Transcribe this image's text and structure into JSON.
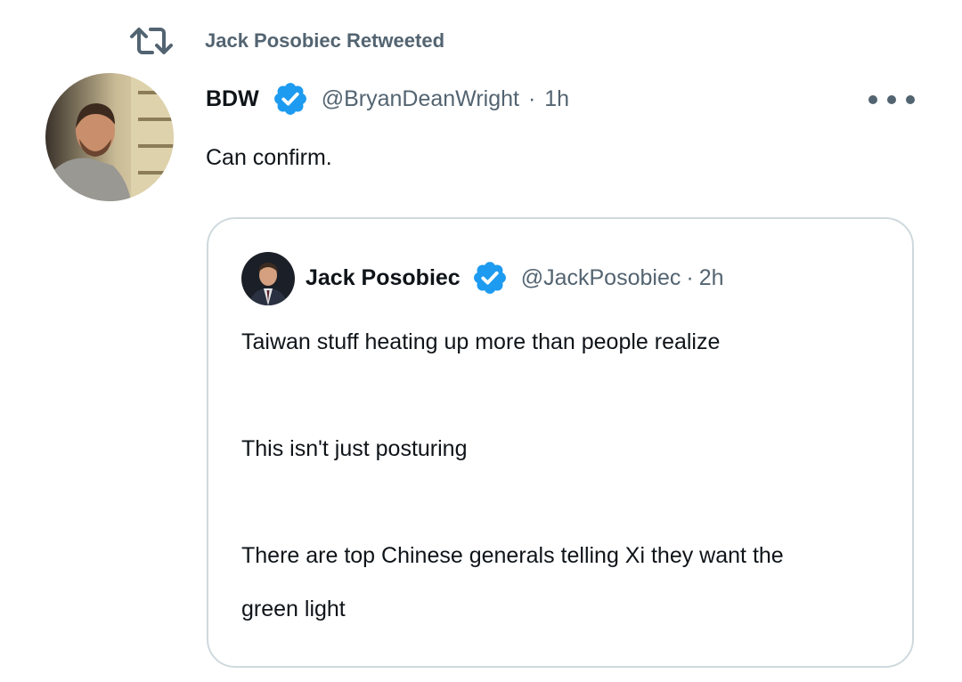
{
  "retweet": {
    "icon": "retweet-icon",
    "label": "Jack Posobiec Retweeted"
  },
  "tweet": {
    "author_name": "BDW",
    "author_handle": "@BryanDeanWright",
    "separator": "·",
    "timestamp": "1h",
    "text": "Can confirm.",
    "more_icon": "more-horizontal-icon"
  },
  "quoted": {
    "author_name": "Jack Posobiec",
    "author_handle": "@JackPosobiec",
    "separator": "·",
    "timestamp": "2h",
    "lines": [
      "Taiwan stuff heating up more than people realize",
      "This isn't just posturing",
      "There are top Chinese generals telling Xi they want the",
      "green light"
    ]
  },
  "colors": {
    "verified_blue": "#1d9bf0",
    "secondary_text": "#536471",
    "primary_text": "#0f1419",
    "card_border": "#cfd9de"
  }
}
